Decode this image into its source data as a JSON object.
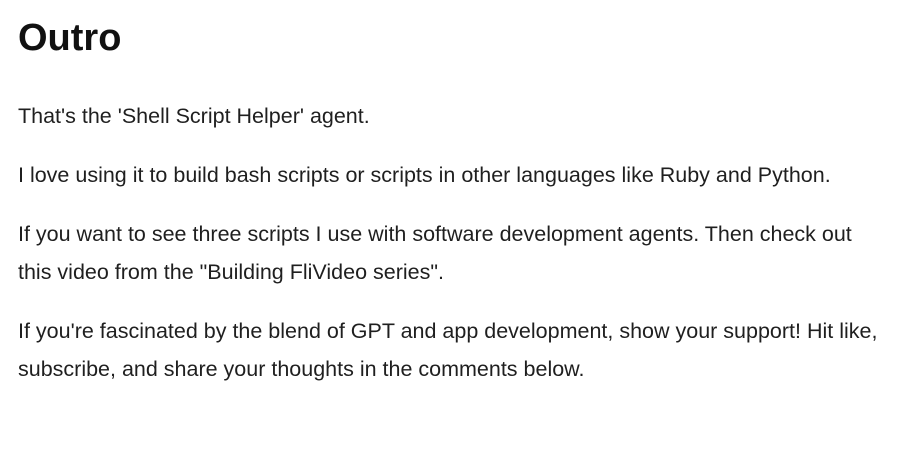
{
  "document": {
    "title": "Outro",
    "paragraphs": [
      "That's the 'Shell Script Helper' agent.",
      "I love using it to build bash scripts or scripts in other languages like Ruby and Python.",
      "If you want to see three scripts I use with software development agents. Then check out this video from the \"Building FliVideo series\".",
      "If you're fascinated by the blend of GPT and app development, show your support! Hit like, subscribe, and share your thoughts in the comments below."
    ]
  }
}
